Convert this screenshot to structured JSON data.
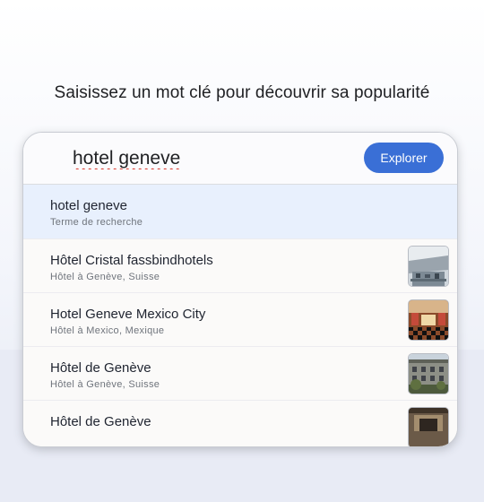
{
  "prompt": "Saisissez un mot clé pour découvrir sa popularité",
  "search": {
    "value": "hotel geneve",
    "button_label": "Explorer"
  },
  "suggestions": [
    {
      "title": "hotel geneve",
      "subtitle": "Terme de recherche",
      "thumbnail": null
    },
    {
      "title": "Hôtel Cristal fassbindhotels",
      "subtitle": "Hôtel à Genève, Suisse",
      "thumbnail": "hotel-lobby-thumbnail"
    },
    {
      "title": "Hotel Geneve Mexico City",
      "subtitle": "Hôtel à Mexico, Mexique",
      "thumbnail": "hotel-hall-checkered-floor-thumbnail"
    },
    {
      "title": "Hôtel de Genève",
      "subtitle": "Hôtel à Genève, Suisse",
      "thumbnail": "hotel-facade-thumbnail"
    },
    {
      "title": "Hôtel de Genève",
      "subtitle": "",
      "thumbnail": "hotel-entrance-thumbnail"
    }
  ],
  "colors": {
    "accent": "#3a6fd6",
    "highlight_row": "#e8f0fd"
  }
}
